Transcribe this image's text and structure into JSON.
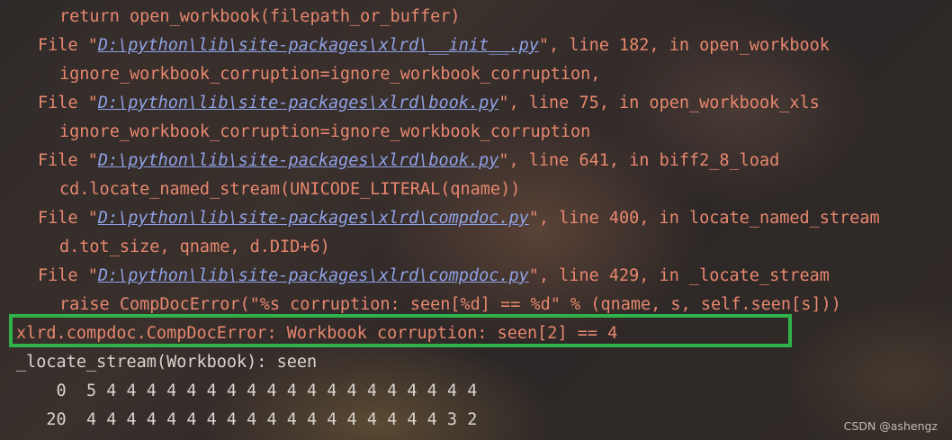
{
  "terminal": {
    "lines": [
      {
        "text": "return open_workbook(filepath_or_buffer)"
      },
      {
        "prefix": "File \"",
        "path": "D:\\python\\lib\\site-packages\\xlrd\\__init__.py",
        "suffix": "\", line 182, in open_workbook"
      },
      {
        "text": "ignore_workbook_corruption=ignore_workbook_corruption,"
      },
      {
        "prefix": "File \"",
        "path": "D:\\python\\lib\\site-packages\\xlrd\\book.py",
        "suffix": "\", line 75, in open_workbook_xls"
      },
      {
        "text": "ignore_workbook_corruption=ignore_workbook_corruption"
      },
      {
        "prefix": "File \"",
        "path": "D:\\python\\lib\\site-packages\\xlrd\\book.py",
        "suffix": "\", line 641, in biff2_8_load"
      },
      {
        "text": "cd.locate_named_stream(UNICODE_LITERAL(qname))"
      },
      {
        "prefix": "File \"",
        "path": "D:\\python\\lib\\site-packages\\xlrd\\compdoc.py",
        "suffix": "\", line 400, in locate_named_stream"
      },
      {
        "text": "d.tot_size, qname, d.DID+6)"
      },
      {
        "prefix": "File \"",
        "path": "D:\\python\\lib\\site-packages\\xlrd\\compdoc.py",
        "suffix": "\", line 429, in _locate_stream"
      },
      {
        "text": "raise CompDocError(\"%s corruption: seen[%d] == %d\" % (qname, s, self.seen[s]))"
      },
      {
        "text": "xlrd.compdoc.CompDocError: Workbook corruption: seen[2] == 4"
      },
      {
        "text": "_locate_stream(Workbook): seen"
      },
      {
        "text": "    0  5 4 4 4 4 4 4 4 4 4 4 4 4 4 4 4 4 4 4 4"
      },
      {
        "text": "   20  4 4 4 4 4 4 4 4 4 4 4 4 4 4 4 4 4 4 3 2"
      }
    ]
  },
  "watermark": "CSDN @ashengz",
  "colors": {
    "error_text": "#e8876f",
    "path_link": "#8fa1e6",
    "plain_text": "#d9d4cf",
    "highlight_border": "#2fb24b"
  }
}
